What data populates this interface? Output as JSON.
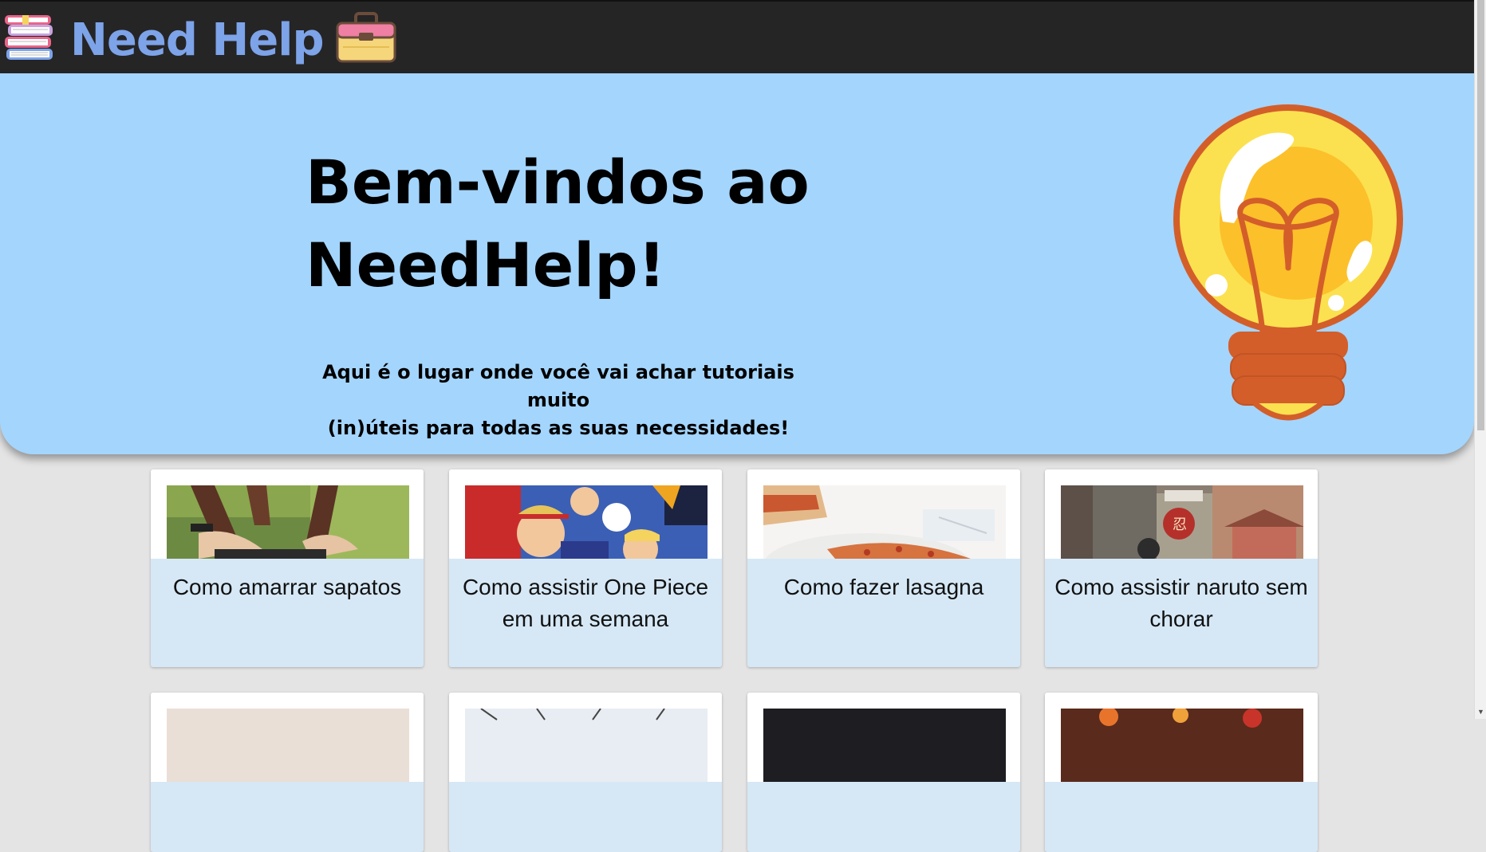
{
  "header": {
    "brand_title": "Need Help",
    "left_icon": "books-stack-icon",
    "right_icon": "toolbox-icon"
  },
  "hero": {
    "title_line1": "Bem-vindos ao",
    "title_line2": "NeedHelp!",
    "subtitle_line1": "Aqui é o lugar onde você vai achar tutoriais muito",
    "subtitle_line2": "(in)úteis para todas as suas necessidades!",
    "icon": "lightbulb-icon"
  },
  "cards": [
    {
      "title": "Como amarrar sapatos",
      "thumb": "shoelace-photo"
    },
    {
      "title": "Como assistir One Piece em uma semana",
      "thumb": "one-piece-art"
    },
    {
      "title": "Como fazer lasagna",
      "thumb": "lasagna-photo"
    },
    {
      "title": "Como assistir naruto sem chorar",
      "thumb": "naruto-scene"
    }
  ],
  "colors": {
    "topbar": "#252526",
    "brand_text": "#7da3e8",
    "hero_bg": "#a4d5fd",
    "card_bg": "#d6e8f6",
    "page_bg": "#e4e4e4"
  }
}
